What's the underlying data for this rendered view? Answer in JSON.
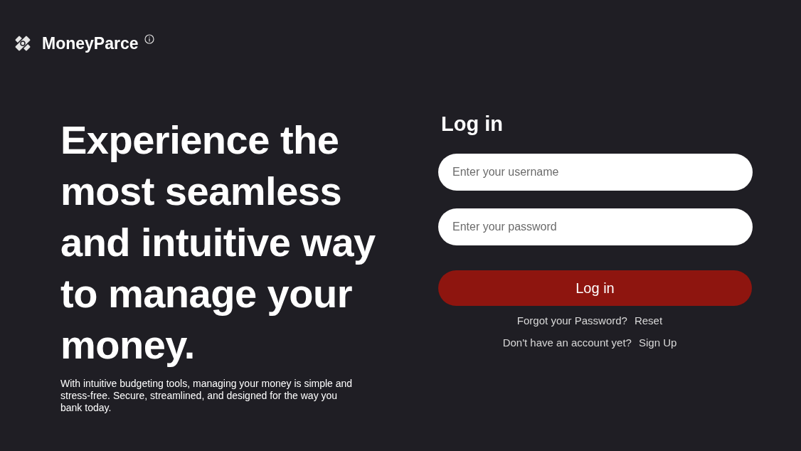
{
  "brand": {
    "name": "MoneyParce"
  },
  "hero": {
    "headline_lines": [
      "Experience the",
      "most seamless",
      "and intuitive way",
      "to manage your",
      "money."
    ],
    "subtext": "With intuitive budgeting tools, managing your money is simple and stress-free. Secure, streamlined, and designed for the way you bank today."
  },
  "login": {
    "title": "Log in",
    "fields": [
      {
        "placeholder": "Enter your username"
      },
      {
        "placeholder": "Enter your password"
      }
    ],
    "submit": "Log in",
    "links": [
      {
        "prompt": "Forgot your Password?",
        "link": "Reset"
      },
      {
        "prompt": "Don't have an account yet?",
        "link": "Sign Up"
      }
    ]
  }
}
